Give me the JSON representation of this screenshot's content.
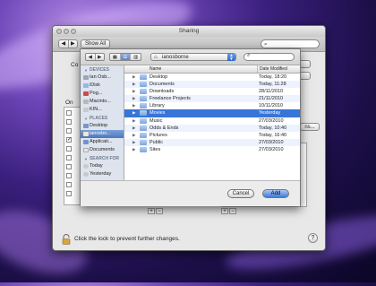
{
  "window": {
    "title": "Sharing"
  },
  "toolbar": {
    "back": "◀",
    "forward": "▶",
    "show_all": "Show All"
  },
  "background_fragments": {
    "computer_label": "Co",
    "on_label": "On",
    "options_button": "ns..."
  },
  "lock": {
    "text": "Click the lock to prevent further changes."
  },
  "help": {
    "label": "?"
  },
  "sheet": {
    "back": "◀",
    "forward": "▶",
    "views": [
      "▦",
      "☰",
      "▥"
    ],
    "location": "ianosborne",
    "sidebar": {
      "devices_header": "DEVICES",
      "devices": [
        "Ian Osb...",
        "iDisk",
        "Pog...",
        "Macinto...",
        "KIN..."
      ],
      "places_header": "PLACES",
      "places": [
        "Desktop",
        "ianosbo...",
        "Applicati...",
        "Documents"
      ],
      "search_header": "SEARCH FOR",
      "search": [
        "Today",
        "Yesterday"
      ]
    },
    "columns": {
      "name": "Name",
      "date": "Date Modified"
    },
    "files": [
      {
        "name": "Desktop",
        "date": "Today, 18:20"
      },
      {
        "name": "Documents",
        "date": "Today, 11:28"
      },
      {
        "name": "Downloads",
        "date": "28/11/2010"
      },
      {
        "name": "Freelance Projects",
        "date": "21/11/2010"
      },
      {
        "name": "Library",
        "date": "10/11/2010"
      },
      {
        "name": "Movies",
        "date": "Yesterday"
      },
      {
        "name": "Music",
        "date": "27/03/2010"
      },
      {
        "name": "Odds & Ends",
        "date": "Today, 10:40"
      },
      {
        "name": "Pictures",
        "date": "Today, 16:40"
      },
      {
        "name": "Public",
        "date": "27/03/2010"
      },
      {
        "name": "Sites",
        "date": "27/03/2010"
      }
    ],
    "selected_file_index": 5,
    "cancel_label": "Cancel",
    "add_label": "Add"
  }
}
